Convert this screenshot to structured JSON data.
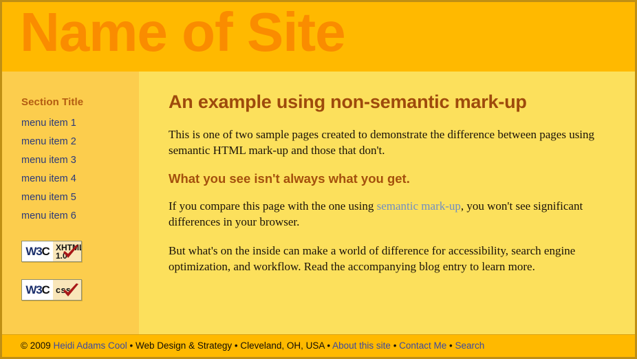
{
  "header": {
    "site_title": "Name of Site",
    "background_color": "#ffb900",
    "title_color": "#fa8c00"
  },
  "sidebar": {
    "background_color": "#fccd4d",
    "section_title": "Section Title",
    "section_title_color": "#b35c11",
    "link_color": "#2b3a7a",
    "menu_items": [
      {
        "label": "menu item 1"
      },
      {
        "label": "menu item 2"
      },
      {
        "label": "menu item 3"
      },
      {
        "label": "menu item 4"
      },
      {
        "label": "menu item 5"
      },
      {
        "label": "menu item 6"
      }
    ],
    "badges": [
      {
        "id": "xhtml",
        "mark": "W3C",
        "line1": "XHTML",
        "line2": "1.0",
        "icon": "w3c-validation-check-icon"
      },
      {
        "id": "css",
        "mark": "W3C",
        "line1": "css",
        "line2": "",
        "icon": "w3c-validation-check-icon"
      }
    ]
  },
  "main": {
    "background_color": "#fce05c",
    "heading": "An example using non-semantic mark-up",
    "heading_color": "#9e4a0c",
    "paragraph1": "This is one of two sample pages created to demonstrate the difference between pages using semantic HTML mark-up and those that don't.",
    "subheading": "What you see isn't always what you get.",
    "subheading_color": "#a4500d",
    "paragraph2_before": "If you compare this page with the one using ",
    "paragraph2_link": "semantic mark-up",
    "paragraph2_after": ", you won't see significant differences in your browser.",
    "paragraph3": "But what's on the inside can make a world of difference for accessibility, search engine optimization, and workflow. Read the accompanying blog entry to learn more.",
    "link_color": "#6f8ec4"
  },
  "footer": {
    "background_color": "#ffb900",
    "link_color": "#3b4aa0",
    "copyright": "© 2009 ",
    "author_link": "Heidi Adams Cool",
    "separator": " • ",
    "tagline": "Web Design & Strategy",
    "location": "Cleveland, OH, USA",
    "link_about": "About this site",
    "link_contact": "Contact Me",
    "link_search": "Search"
  }
}
